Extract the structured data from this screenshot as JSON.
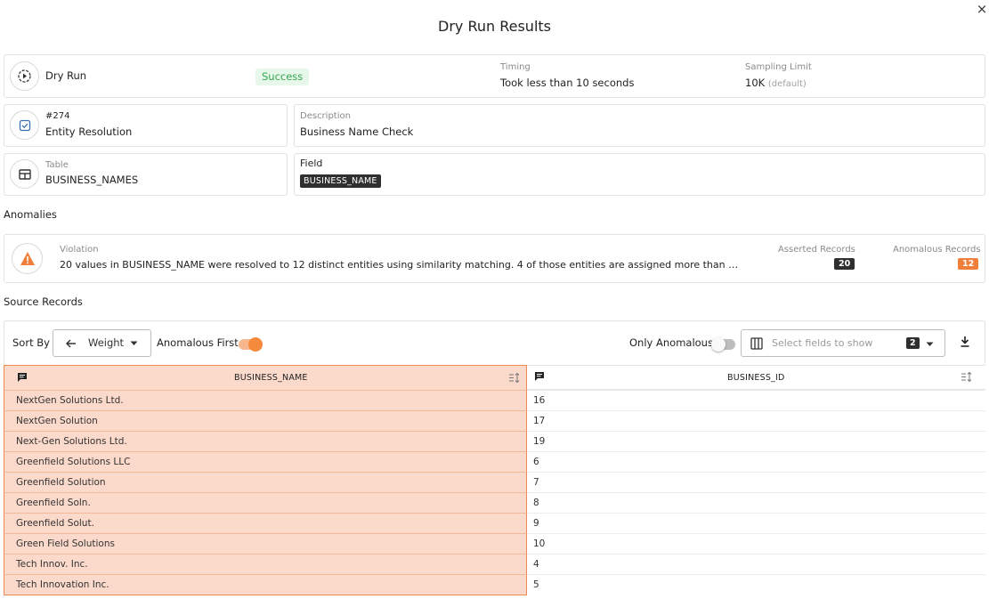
{
  "dialog": {
    "title": "Dry Run Results",
    "close_glyph": "×"
  },
  "summary": {
    "run_label": "Dry Run",
    "status": "Success",
    "timing_label": "Timing",
    "timing_value": "Took less than 10 seconds",
    "sampling_label": "Sampling Limit",
    "sampling_value": "10K",
    "sampling_note": "(default)"
  },
  "check": {
    "id": "#274",
    "rule_type": "Entity Resolution",
    "description_label": "Description",
    "description_value": "Business Name Check"
  },
  "target": {
    "table_label": "Table",
    "table_value": "BUSINESS_NAMES",
    "field_label": "Field",
    "field_value": "BUSINESS_NAME"
  },
  "anomalies": {
    "section_title": "Anomalies",
    "violation_label": "Violation",
    "violation_text": "20 values in BUSINESS_NAME were resolved to 12 distinct entities using similarity matching. 4 of those entities are assigned more than one val...",
    "asserted_label": "Asserted Records",
    "asserted_count": "20",
    "anomalous_label": "Anomalous Records",
    "anomalous_count": "12"
  },
  "source": {
    "section_title": "Source Records",
    "sort_by_label": "Sort By",
    "sort_value": "Weight",
    "anomalous_first_label": "Anomalous First",
    "anomalous_first_on": true,
    "only_anomalous_label": "Only Anomalous",
    "only_anomalous_on": false,
    "fields_placeholder": "Select fields to show",
    "fields_count": "2"
  },
  "table": {
    "columns": [
      "BUSINESS_NAME",
      "BUSINESS_ID"
    ],
    "rows": [
      [
        "NextGen Solutions Ltd.",
        "16"
      ],
      [
        "NextGen Solution",
        "17"
      ],
      [
        "Next-Gen Solutions Ltd.",
        "19"
      ],
      [
        "Greenfield Solutions LLC",
        "6"
      ],
      [
        "Greenfield Solution",
        "7"
      ],
      [
        "Greenfield Soln.",
        "8"
      ],
      [
        "Greenfield Solut.",
        "9"
      ],
      [
        "Green Field Solutions",
        "10"
      ],
      [
        "Tech Innov. Inc.",
        "4"
      ],
      [
        "Tech Innovation Inc.",
        "5"
      ]
    ]
  },
  "colors": {
    "accent_orange": "#f07f3c",
    "anomaly_bg": "#fbd9cb",
    "success_bg": "#e7f7e9",
    "success_text": "#34a853"
  }
}
